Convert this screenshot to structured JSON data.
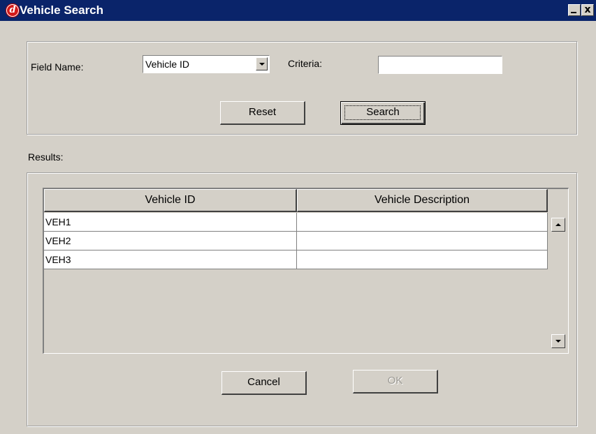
{
  "window": {
    "title": "Vehicle Search",
    "logo_letter": "d",
    "minimize_label": "",
    "close_label": "x"
  },
  "search": {
    "field_name_label": "Field Name:",
    "field_name_value": "Vehicle ID",
    "criteria_label": "Criteria:",
    "criteria_value": "",
    "reset_label": "Reset",
    "search_label": "Search"
  },
  "results": {
    "label": "Results:",
    "columns": [
      "Vehicle ID",
      "Vehicle Description"
    ],
    "rows": [
      [
        "VEH1",
        ""
      ],
      [
        "VEH2",
        ""
      ],
      [
        "VEH3",
        ""
      ]
    ]
  },
  "footer": {
    "cancel_label": "Cancel",
    "ok_label": "OK",
    "ok_enabled": false
  },
  "colors": {
    "titlebar": "#0a246a",
    "window_bg": "#d4d0c8",
    "logo_red": "#d41a1a"
  }
}
